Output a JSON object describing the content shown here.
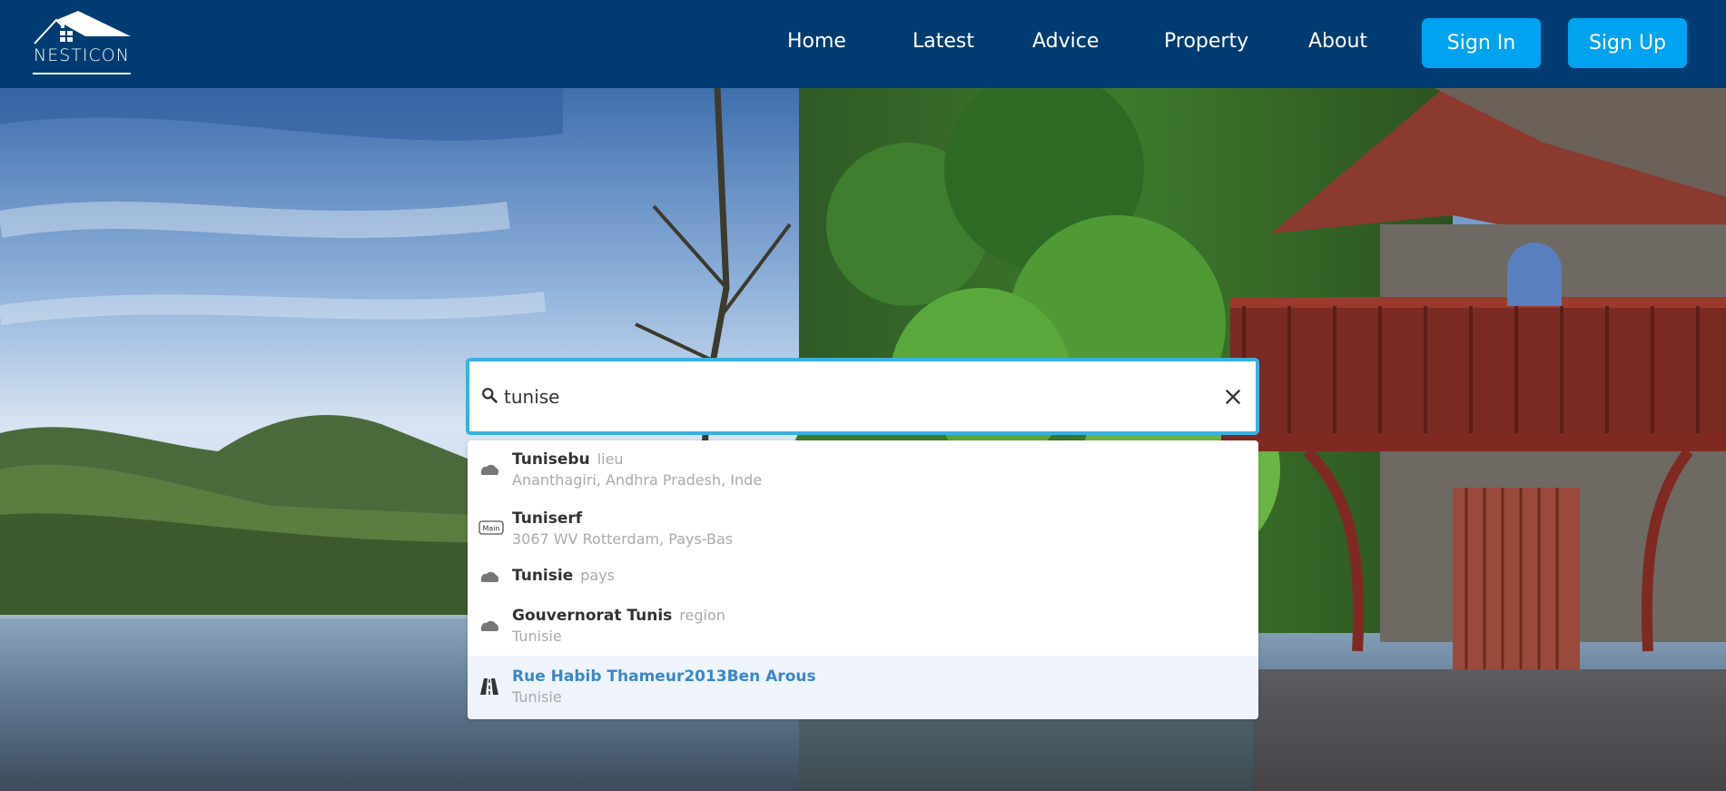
{
  "brand": {
    "name": "NESTICON"
  },
  "nav": {
    "home": "Home",
    "latest": "Latest",
    "advice": "Advice",
    "property": "Property",
    "about": "About"
  },
  "auth": {
    "sign_in": "Sign In",
    "sign_up": "Sign Up"
  },
  "search": {
    "value": "tunise",
    "icon": "search-icon",
    "clear_icon": "close-icon"
  },
  "suggestions": [
    {
      "title": "Tunisebu",
      "type": "lieu",
      "subtitle": "Ananthagiri, Andhra Pradesh, Inde",
      "icon": "place-icon"
    },
    {
      "title": "Tuniserf",
      "type": "",
      "subtitle": "3067 WV Rotterdam, Pays-Bas",
      "icon": "main-road-icon",
      "icon_text": "Main"
    },
    {
      "title": "Tunisie",
      "type": "pays",
      "subtitle": "",
      "icon": "place-icon"
    },
    {
      "title": "Gouvernorat Tunis",
      "type": "region",
      "subtitle": "Tunisie",
      "icon": "place-icon"
    },
    {
      "title": "Rue Habib Thameur2013Ben Arous",
      "type": "",
      "subtitle": "Tunisie",
      "icon": "road-icon",
      "highlighted": true
    }
  ],
  "colors": {
    "header_bg": "#003c71",
    "button_bg": "#00a3f0",
    "search_border": "#3ab0e0",
    "highlight_text": "#3a86c8",
    "highlight_bg": "#eef3fc"
  }
}
